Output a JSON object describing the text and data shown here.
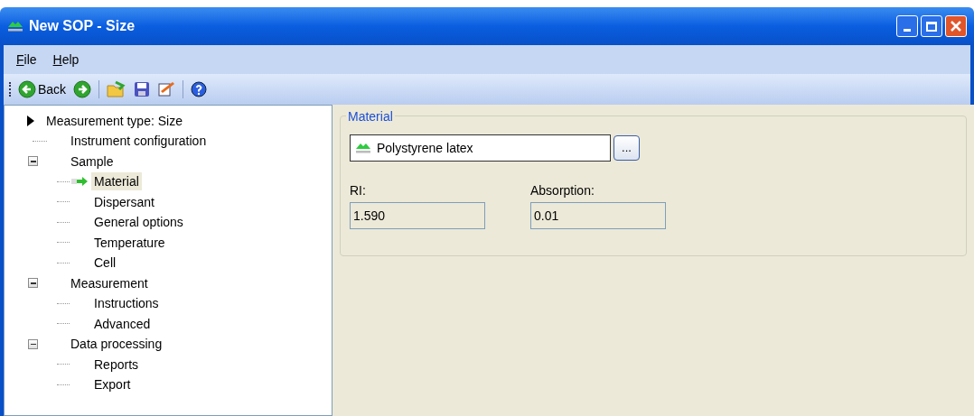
{
  "window": {
    "title": "New SOP - Size"
  },
  "menu": [
    {
      "label": "File"
    },
    {
      "label": "Help"
    }
  ],
  "toolbar": {
    "back_label": "Back"
  },
  "tree": {
    "root": "Measurement type: Size",
    "items": [
      {
        "label": "Instrument configuration",
        "selected": false
      },
      {
        "label": "Sample",
        "selected": false,
        "expanded": true,
        "children": [
          {
            "label": "Material",
            "selected": true
          },
          {
            "label": "Dispersant",
            "selected": false
          },
          {
            "label": "General options",
            "selected": false
          },
          {
            "label": "Temperature",
            "selected": false
          },
          {
            "label": "Cell",
            "selected": false
          }
        ]
      },
      {
        "label": "Measurement",
        "selected": false,
        "expanded": true,
        "children": [
          {
            "label": "Instructions",
            "selected": false
          },
          {
            "label": "Advanced",
            "selected": false
          }
        ]
      },
      {
        "label": "Data processing",
        "selected": false,
        "expanded": true,
        "children": [
          {
            "label": "Reports",
            "selected": false
          },
          {
            "label": "Export",
            "selected": false
          }
        ]
      }
    ]
  },
  "material_group": {
    "title": "Material",
    "material": "Polystyrene latex",
    "browse_label": "...",
    "fields": [
      {
        "label": "RI:",
        "value": "1.590"
      },
      {
        "label": "Absorption:",
        "value": "0.01"
      }
    ]
  }
}
